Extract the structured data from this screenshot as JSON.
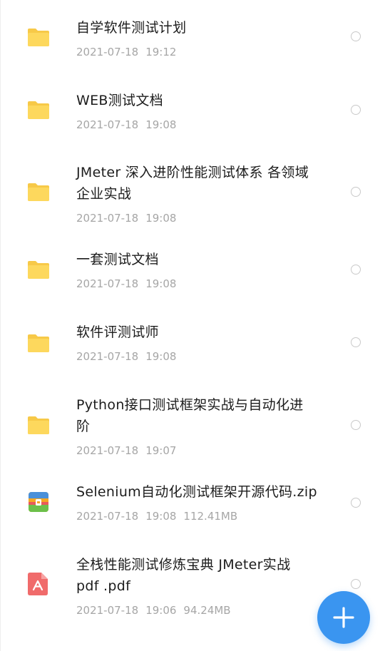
{
  "files": [
    {
      "type": "folder",
      "name": "自学软件测试计划",
      "date": "2021-07-18",
      "time": "19:12",
      "size": ""
    },
    {
      "type": "folder",
      "name": "WEB测试文档",
      "date": "2021-07-18",
      "time": "19:08",
      "size": ""
    },
    {
      "type": "folder",
      "name": "JMeter 深入进阶性能测试体系 各领域\n企业实战",
      "date": "2021-07-18",
      "time": "19:08",
      "size": ""
    },
    {
      "type": "folder",
      "name": "一套测试文档",
      "date": "2021-07-18",
      "time": "19:08",
      "size": ""
    },
    {
      "type": "folder",
      "name": "软件评测试师",
      "date": "2021-07-18",
      "time": "19:08",
      "size": ""
    },
    {
      "type": "folder",
      "name": "Python接口测试框架实战与自动化进\n阶",
      "date": "2021-07-18",
      "time": "19:07",
      "size": ""
    },
    {
      "type": "zip",
      "name": "Selenium自动化测试框架开源代码.zip",
      "date": "2021-07-18",
      "time": "19:08",
      "size": "112.41MB"
    },
    {
      "type": "pdf",
      "name": "全栈性能测试修炼宝典 JMeter实战\npdf .pdf",
      "date": "2021-07-18",
      "time": "19:06",
      "size": "94.24MB"
    }
  ],
  "icons": {
    "folder": "folder-icon",
    "zip": "zip-archive-icon",
    "pdf": "pdf-file-icon",
    "add": "plus-icon"
  },
  "colors": {
    "folder": "#fdd85d",
    "folder_tab": "#f7c948",
    "fab": "#3a95f0",
    "pdf": "#f06b6b",
    "text": "#1c1c1c",
    "meta": "#a6a6a6"
  }
}
